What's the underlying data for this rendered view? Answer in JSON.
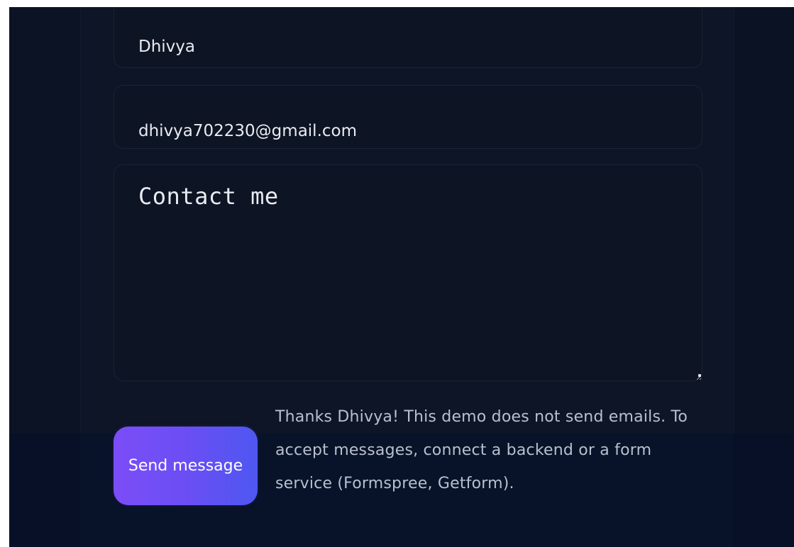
{
  "contact_form": {
    "name_value": "Dhivya",
    "email_value": "dhivya702230@gmail.com",
    "message_value": "Contact me",
    "send_button_label": "Send message",
    "status_message": "Thanks Dhivya! This demo does not send emails. To accept messages, connect a backend or a form service (Formspree, Getform)."
  },
  "colors": {
    "page_background": "#0a1121",
    "field_background": "#0d1423",
    "button_gradient_start": "#7b4df7",
    "button_gradient_end": "#4e57f1",
    "status_text": "#b8c0cf"
  }
}
